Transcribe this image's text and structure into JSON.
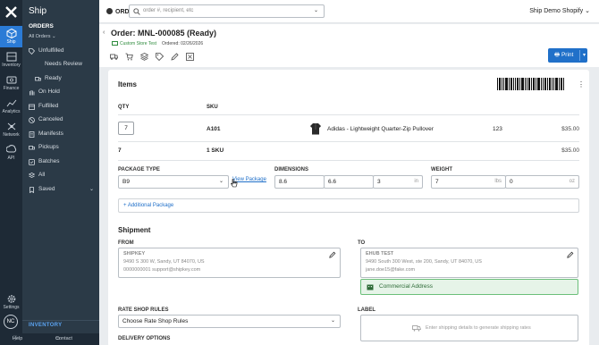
{
  "rail": {
    "items": [
      {
        "label": "Ship",
        "icon": "ship-icon",
        "active": true
      },
      {
        "label": "Inventory",
        "icon": "inventory-icon"
      },
      {
        "label": "Finance",
        "icon": "finance-icon"
      },
      {
        "label": "Analytics",
        "icon": "analytics-icon"
      },
      {
        "label": "Network",
        "icon": "network-icon"
      },
      {
        "label": "API",
        "icon": "api-icon"
      }
    ],
    "settings": "Settings",
    "avatar": "NC"
  },
  "sidebar": {
    "app_title": "Ship",
    "section_title": "ORDERS",
    "all_orders": "All Orders",
    "items": [
      {
        "label": "Unfulfilled",
        "icon": "tag-icon"
      },
      {
        "label": "Needs Review"
      },
      {
        "label": "Ready"
      },
      {
        "label": "On Hold",
        "icon": "hand-icon"
      },
      {
        "label": "Fulfilled",
        "icon": "box-icon"
      },
      {
        "label": "Canceled",
        "icon": "ban-icon"
      },
      {
        "label": "Manifests",
        "icon": "doc-icon"
      },
      {
        "label": "Pickups",
        "icon": "truck-icon"
      },
      {
        "label": "Batches",
        "icon": "layers-icon"
      },
      {
        "label": "All",
        "icon": "list-icon"
      },
      {
        "label": "Saved",
        "icon": "bookmark-icon"
      }
    ],
    "inventory": "INVENTORY",
    "help": "Help Center",
    "contact": "Contact Us"
  },
  "topbar": {
    "order_label": "ORDER",
    "search_placeholder": "order #, recipient, etc",
    "store": "Ship Demo Shopify"
  },
  "order": {
    "title": "Order: MNL-000085  (Ready)",
    "store_tag": "Custom Store Test",
    "ordered": "Ordered: 02/26/2026",
    "print_label": "Print"
  },
  "items": {
    "title": "Items",
    "col_qty": "QTY",
    "col_sku": "SKU",
    "row": {
      "qty": "7",
      "sku": "A101",
      "name": "Adidas - Lightweight Quarter-Zip Pullover",
      "count": "123",
      "price": "$35.00"
    },
    "summary": {
      "qty": "7",
      "sku": "1 SKU",
      "price": "$35.00"
    }
  },
  "package": {
    "type_label": "PACKAGE TYPE",
    "type_value": "B9",
    "view_link": "View Package",
    "dims_label": "DIMENSIONS",
    "dim_l": "8.6",
    "dim_w": "6.6",
    "dim_h": "3",
    "dim_unit": "in",
    "weight_label": "WEIGHT",
    "weight_lbs": "7",
    "weight_lbs_unit": "lbs",
    "weight_oz": "0",
    "weight_oz_unit": "oz",
    "additional": "+ Additional Package"
  },
  "shipment": {
    "title": "Shipment",
    "from_label": "FROM",
    "from_name": "SHIPKEY",
    "from_addr": "9490 S 300 W, Sandy, UT 84070, US",
    "from_contact": "0000000001 support@shipkey.com",
    "to_label": "TO",
    "to_name": "EHUB TEST",
    "to_addr": "9490 South 300 West, ste 200, Sandy, UT 84070, US",
    "to_email": "jane.doe15@fake.com",
    "commercial": "Commercial Address",
    "rate_label": "RATE SHOP RULES",
    "rate_placeholder": "Choose Rate Shop Rules",
    "delivery_label": "DELIVERY OPTIONS",
    "label_label": "LABEL",
    "label_hint": "Enter shipping details to generate shipping rates"
  },
  "colors": {
    "accent": "#2070c9",
    "rail_bg": "#1e2a36",
    "sidebar_bg": "#2b3a47",
    "success": "#2e8b3d"
  }
}
